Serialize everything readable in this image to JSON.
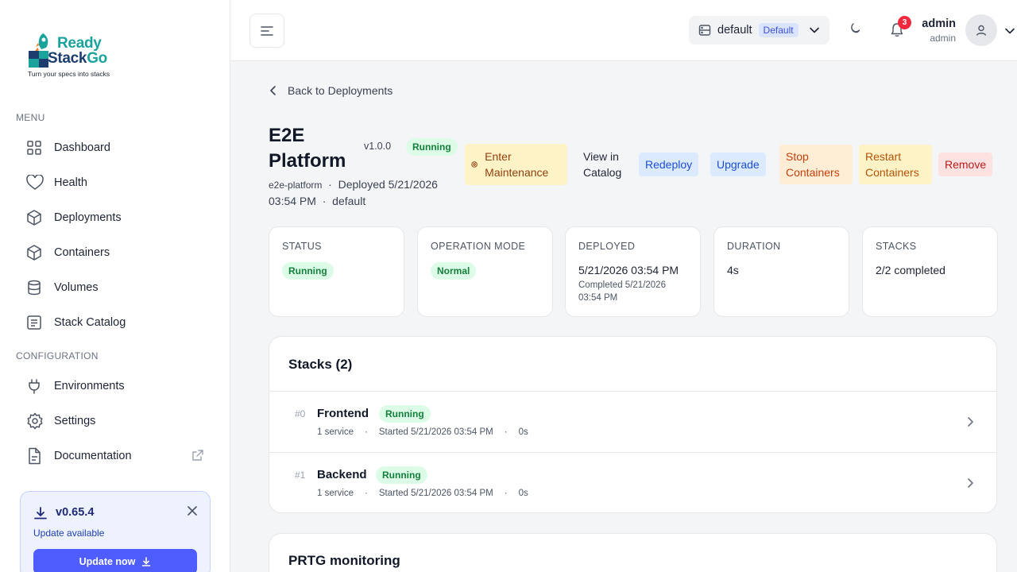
{
  "brand": {
    "name_line1": "Ready",
    "name_line2a": "Stack",
    "name_line2b": "Go",
    "tagline": "Turn your specs into stacks"
  },
  "sidebar": {
    "menu_label": "MENU",
    "menu_items": [
      {
        "label": "Dashboard",
        "icon": "grid-icon"
      },
      {
        "label": "Health",
        "icon": "heart-icon"
      },
      {
        "label": "Deployments",
        "icon": "cube-icon"
      },
      {
        "label": "Containers",
        "icon": "cube-icon"
      },
      {
        "label": "Volumes",
        "icon": "database-icon"
      },
      {
        "label": "Stack Catalog",
        "icon": "list-icon"
      }
    ],
    "config_label": "CONFIGURATION",
    "config_items": [
      {
        "label": "Environments",
        "icon": "plug-icon"
      },
      {
        "label": "Settings",
        "icon": "gear-icon"
      },
      {
        "label": "Documentation",
        "icon": "document-icon"
      }
    ],
    "update": {
      "version": "v0.65.4",
      "text": "Update available",
      "button": "Update now"
    }
  },
  "header": {
    "environment": "default",
    "environment_badge": "Default",
    "notifications": "3",
    "user_name": "admin",
    "user_role": "admin"
  },
  "page": {
    "back_label": "Back to Deployments",
    "title": "E2E Platform",
    "version": "v1.0.0",
    "status": "Running",
    "slug": "e2e-platform",
    "deployed_text": "Deployed 5/21/2026 03:54 PM",
    "environment": "default",
    "actions": {
      "maintenance": "Enter Maintenance",
      "catalog": "View in Catalog",
      "redeploy": "Redeploy",
      "upgrade": "Upgrade",
      "stop": "Stop Containers",
      "restart": "Restart Containers",
      "remove": "Remove"
    }
  },
  "stats": {
    "status_label": "STATUS",
    "status_value": "Running",
    "mode_label": "OPERATION MODE",
    "mode_value": "Normal",
    "deployed_label": "DEPLOYED",
    "deployed_value": "5/21/2026 03:54 PM",
    "deployed_sub": "Completed 5/21/2026 03:54 PM",
    "duration_label": "DURATION",
    "duration_value": "4s",
    "stacks_label": "STACKS",
    "stacks_value": "2/2 completed"
  },
  "stacks": {
    "heading": "Stacks (2)",
    "items": [
      {
        "index": "#0",
        "name": "Frontend",
        "status": "Running",
        "services": "1 service",
        "started": "Started 5/21/2026 03:54 PM",
        "duration": "0s"
      },
      {
        "index": "#1",
        "name": "Backend",
        "status": "Running",
        "services": "1 service",
        "started": "Started 5/21/2026 03:54 PM",
        "duration": "0s"
      }
    ]
  },
  "monitoring": {
    "heading": "PRTG monitoring"
  },
  "colors": {
    "accent": "#4f5dff",
    "running_bg": "#dcfce7",
    "running_text": "#15803d"
  }
}
